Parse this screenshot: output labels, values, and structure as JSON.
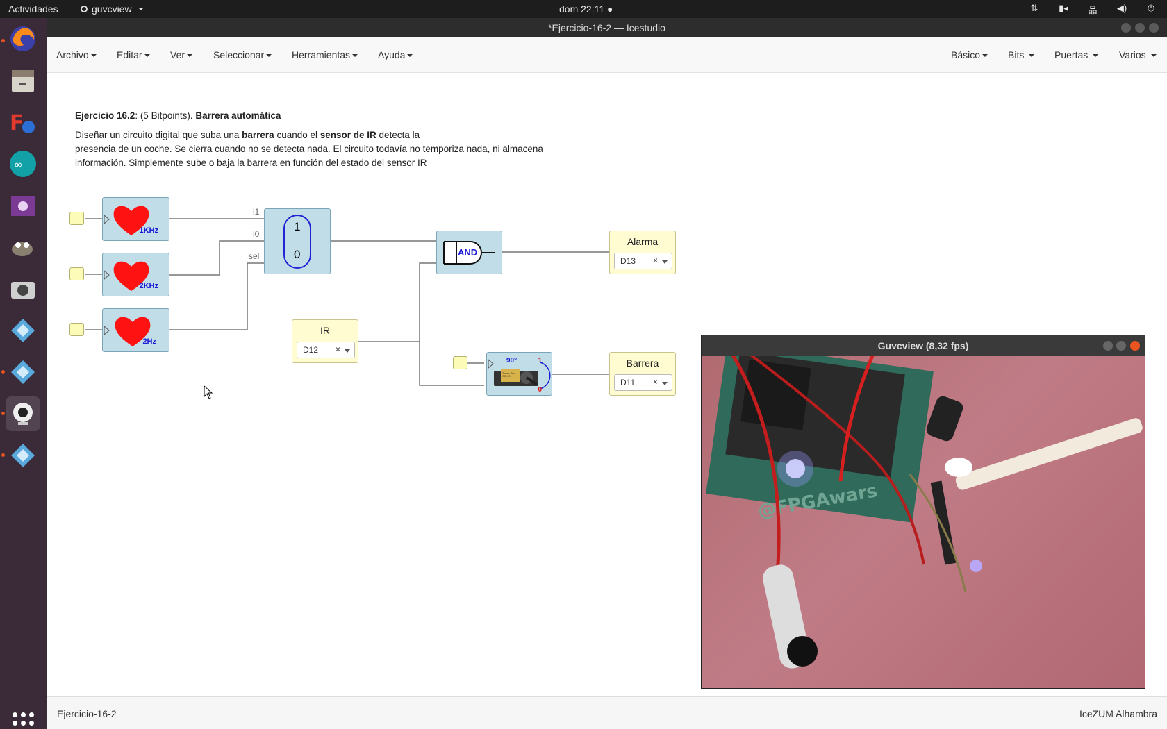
{
  "topbar": {
    "activities": "Actividades",
    "app_name": "guvcview",
    "clock": "dom 22:11 ●"
  },
  "window": {
    "title": "*Ejercicio-16-2 — Icestudio"
  },
  "menubar": {
    "left": [
      "Archivo",
      "Editar",
      "Ver",
      "Seleccionar",
      "Herramientas",
      "Ayuda"
    ],
    "right": [
      "Básico",
      "Bits",
      "Puertas",
      "Varios"
    ]
  },
  "description": {
    "exercise": "Ejercicio 16.2",
    "points": ": (5 Bitpoints). ",
    "title": "Barrera automática",
    "p1_a": "Diseñar un circuito digital que suba una ",
    "p1_b": "barrera",
    "p1_c": " cuando el ",
    "p1_d": "sensor de IR",
    "p1_e": " detecta la",
    "line2": "presencia de un coche. Se cierra cuando no se detecta nada. El circuito todavía no temporiza nada, ni almacena",
    "line3": "información. Simplemente sube o baja la barrera en función del estado del sensor IR"
  },
  "circuit": {
    "clocks": [
      "1KHz",
      "2KHz",
      "2Hz"
    ],
    "mux": {
      "top": "1",
      "bottom": "0",
      "ports": [
        "i1",
        "i0",
        "sel"
      ]
    },
    "and_gate": "AND",
    "servo": {
      "angle": "90°",
      "high": "1",
      "low": "0",
      "brand": "Tower Pro SG-90"
    },
    "inputs": [
      {
        "label": "IR",
        "pin": "D12"
      }
    ],
    "outputs": [
      {
        "label": "Alarma",
        "pin": "D13"
      },
      {
        "label": "Barrera",
        "pin": "D11"
      }
    ],
    "clear_symbol": "×"
  },
  "video_window": {
    "title": "Guvcview  (8,32 fps)",
    "board_text": "@FPGAwars"
  },
  "statusbar": {
    "left": "Ejercicio-16-2",
    "right": "IceZUM Alhambra"
  }
}
